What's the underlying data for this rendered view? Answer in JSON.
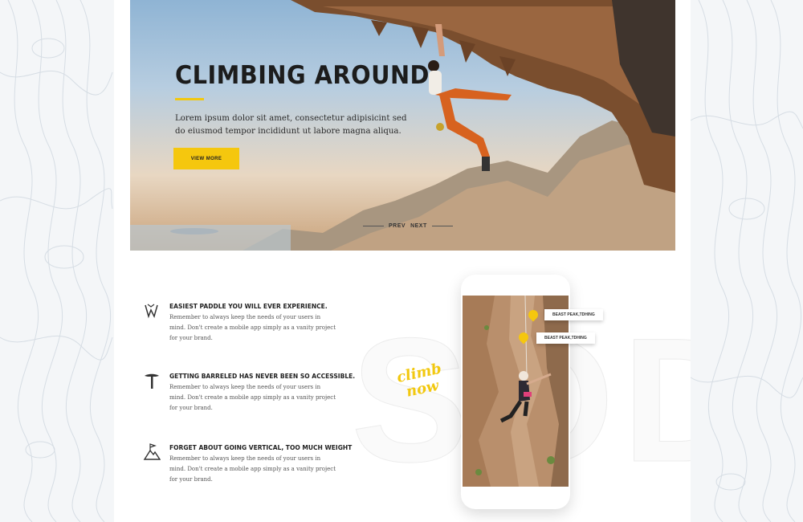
{
  "hero": {
    "title": "CLIMBING AROUND",
    "description": "Lorem ipsum dolor sit amet, consectetur adipisicint sed do eiusmod tempor incididunt ut labore magna aliqua.",
    "button_label": "VIEW MORE",
    "prev_label": "PREV",
    "next_label": "NEXT"
  },
  "features": [
    {
      "icon": "climbing-shoe-icon",
      "title": "EASIEST PADDLE YOU WILL EVER EXPERIENCE.",
      "text": "Remember to always keep the needs of your users in mind. Don't create a mobile app simply as a vanity project for your brand."
    },
    {
      "icon": "ice-axe-icon",
      "title": "GETTING BARRELED HAS NEVER BEEN SO ACCESSIBLE.",
      "text": "Remember to always keep the needs of your users in mind. Don't create a mobile app simply as a vanity project for your brand."
    },
    {
      "icon": "mountain-flag-icon",
      "title": "FORGET ABOUT GOING VERTICAL, TOO MUCH WEIGHT",
      "text": "Remember to always keep the needs of your users in mind. Don't create a mobile app simply as a vanity project for your brand."
    }
  ],
  "promo": {
    "script_line1": "climb",
    "script_line2": "now",
    "background_text": "SOD"
  },
  "phone": {
    "tags": [
      "BEAST PEAK,TDHING",
      "BEAST PEAK,TDHING"
    ]
  },
  "colors": {
    "accent": "#f5c70e",
    "text_dark": "#1c1c1c",
    "page_bg": "#f4f6f8"
  }
}
